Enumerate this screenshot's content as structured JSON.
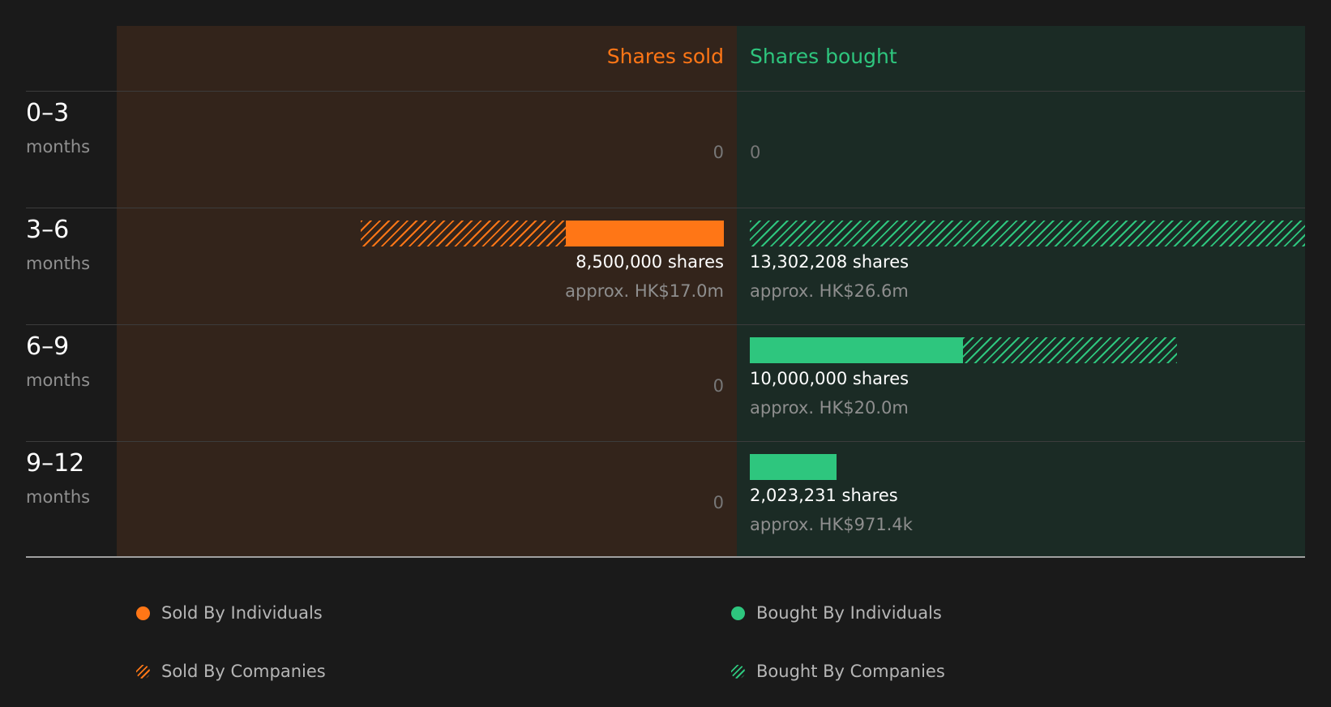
{
  "colors": {
    "sold": "#ff7616",
    "bought": "#2ec67e"
  },
  "headers": {
    "sold": "Shares sold",
    "bought": "Shares bought"
  },
  "chart_data": {
    "type": "bar",
    "orientation": "horizontal-diverging",
    "categories": [
      "0–3 months",
      "3–6 months",
      "6–9 months",
      "9–12 months"
    ],
    "period_labels": [
      {
        "range": "0–3",
        "unit": "months"
      },
      {
        "range": "3–6",
        "unit": "months"
      },
      {
        "range": "6–9",
        "unit": "months"
      },
      {
        "range": "9–12",
        "unit": "months"
      }
    ],
    "max_shares": 13302208,
    "series": [
      {
        "name": "Sold By Individuals",
        "side": "sold",
        "pattern": "solid",
        "values": [
          0,
          3700000,
          0,
          0
        ]
      },
      {
        "name": "Sold By Companies",
        "side": "sold",
        "pattern": "hatched",
        "values": [
          0,
          4800000,
          0,
          0
        ]
      },
      {
        "name": "Bought By Individuals",
        "side": "bought",
        "pattern": "solid",
        "values": [
          0,
          0,
          5000000,
          2023231
        ]
      },
      {
        "name": "Bought By Companies",
        "side": "bought",
        "pattern": "hatched",
        "values": [
          0,
          13302208,
          5000000,
          0
        ]
      }
    ],
    "labels": {
      "sold": [
        {
          "zero": "0"
        },
        {
          "shares": "8,500,000 shares",
          "approx": "approx. HK$17.0m"
        },
        {
          "zero": "0"
        },
        {
          "zero": "0"
        }
      ],
      "bought": [
        {
          "zero": "0"
        },
        {
          "shares": "13,302,208 shares",
          "approx": "approx. HK$26.6m"
        },
        {
          "shares": "10,000,000 shares",
          "approx": "approx. HK$20.0m"
        },
        {
          "shares": "2,023,231 shares",
          "approx": "approx. HK$971.4k"
        }
      ]
    }
  },
  "legend": [
    {
      "label": "Sold By Individuals",
      "side": "sold",
      "pattern": "solid"
    },
    {
      "label": "Sold By Companies",
      "side": "sold",
      "pattern": "hatched"
    },
    {
      "label": "Bought By Individuals",
      "side": "bought",
      "pattern": "solid"
    },
    {
      "label": "Bought By Companies",
      "side": "bought",
      "pattern": "hatched"
    }
  ]
}
